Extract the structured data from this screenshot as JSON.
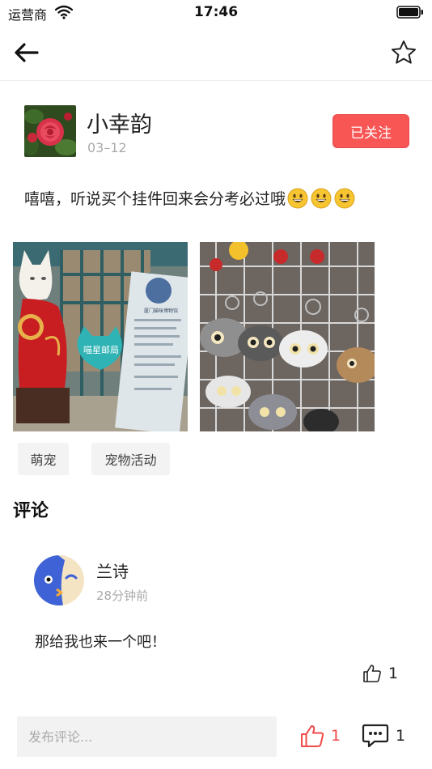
{
  "status_bar": {
    "carrier": "运营商",
    "time": "17:46"
  },
  "post": {
    "author": "小幸韵",
    "date": "03–12",
    "follow_label": "已关注",
    "text": "嘻嘻，听说买个挂件回来会分考必过哦",
    "emoji_count": 3,
    "tags": [
      "萌宠",
      "宠物活动"
    ],
    "photo1_sign": "喵星邮局",
    "photo2_panel": "厦门猫咪博物馆"
  },
  "comments": {
    "title": "评论",
    "items": [
      {
        "user": "兰诗",
        "time": "28分钟前",
        "text": "那给我也来一个吧！",
        "likes": "1"
      }
    ]
  },
  "bottom_bar": {
    "placeholder": "发布评论...",
    "like_count": "1",
    "comment_count": "1"
  },
  "colors": {
    "accent": "#f85555",
    "muted": "#aaaaaa",
    "tag_bg": "#f3f3f3"
  }
}
